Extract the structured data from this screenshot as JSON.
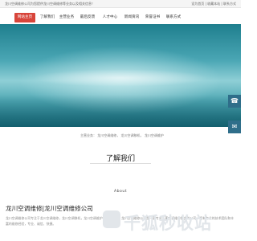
{
  "topbar": {
    "left_text": "龙川空调维修公司为您提供龙川空调维修等业务以及相关信息！",
    "right_text": "设为首页 | 收藏本站 | 联系方式"
  },
  "nav": {
    "items": [
      "网站主页",
      "了解我们",
      "主营业务",
      "最后反馈",
      "人才中心",
      "新闻资讯",
      "荣誉证书",
      "联系方式"
    ],
    "active_index": 0,
    "active_color": "#d8453b"
  },
  "banner": {
    "colors": [
      "#1f7f8e",
      "#8fcfd6",
      "#1f7e8c"
    ]
  },
  "side": {
    "phone_icon": "phone-icon",
    "chat_icon": "chat-icon"
  },
  "mainbiz_text": "主营业务：  龙川空调维修，  龙川空调移机，  龙川空调维护",
  "about": {
    "title": "了解我们",
    "subtitle": "About",
    "company_name": "龙川空调维修|龙川空调维修公司",
    "description": "龙川空调维修公司专注于龙川空调维修，龙川空调移机，龙川空调维护等相关业务，龙川空调维修公司是一家专业从事空调维修服务的公司，拥有专业的技术团队和丰富的维修经验，专业、诚信、快捷。"
  },
  "watermark": "千狐秒收站"
}
